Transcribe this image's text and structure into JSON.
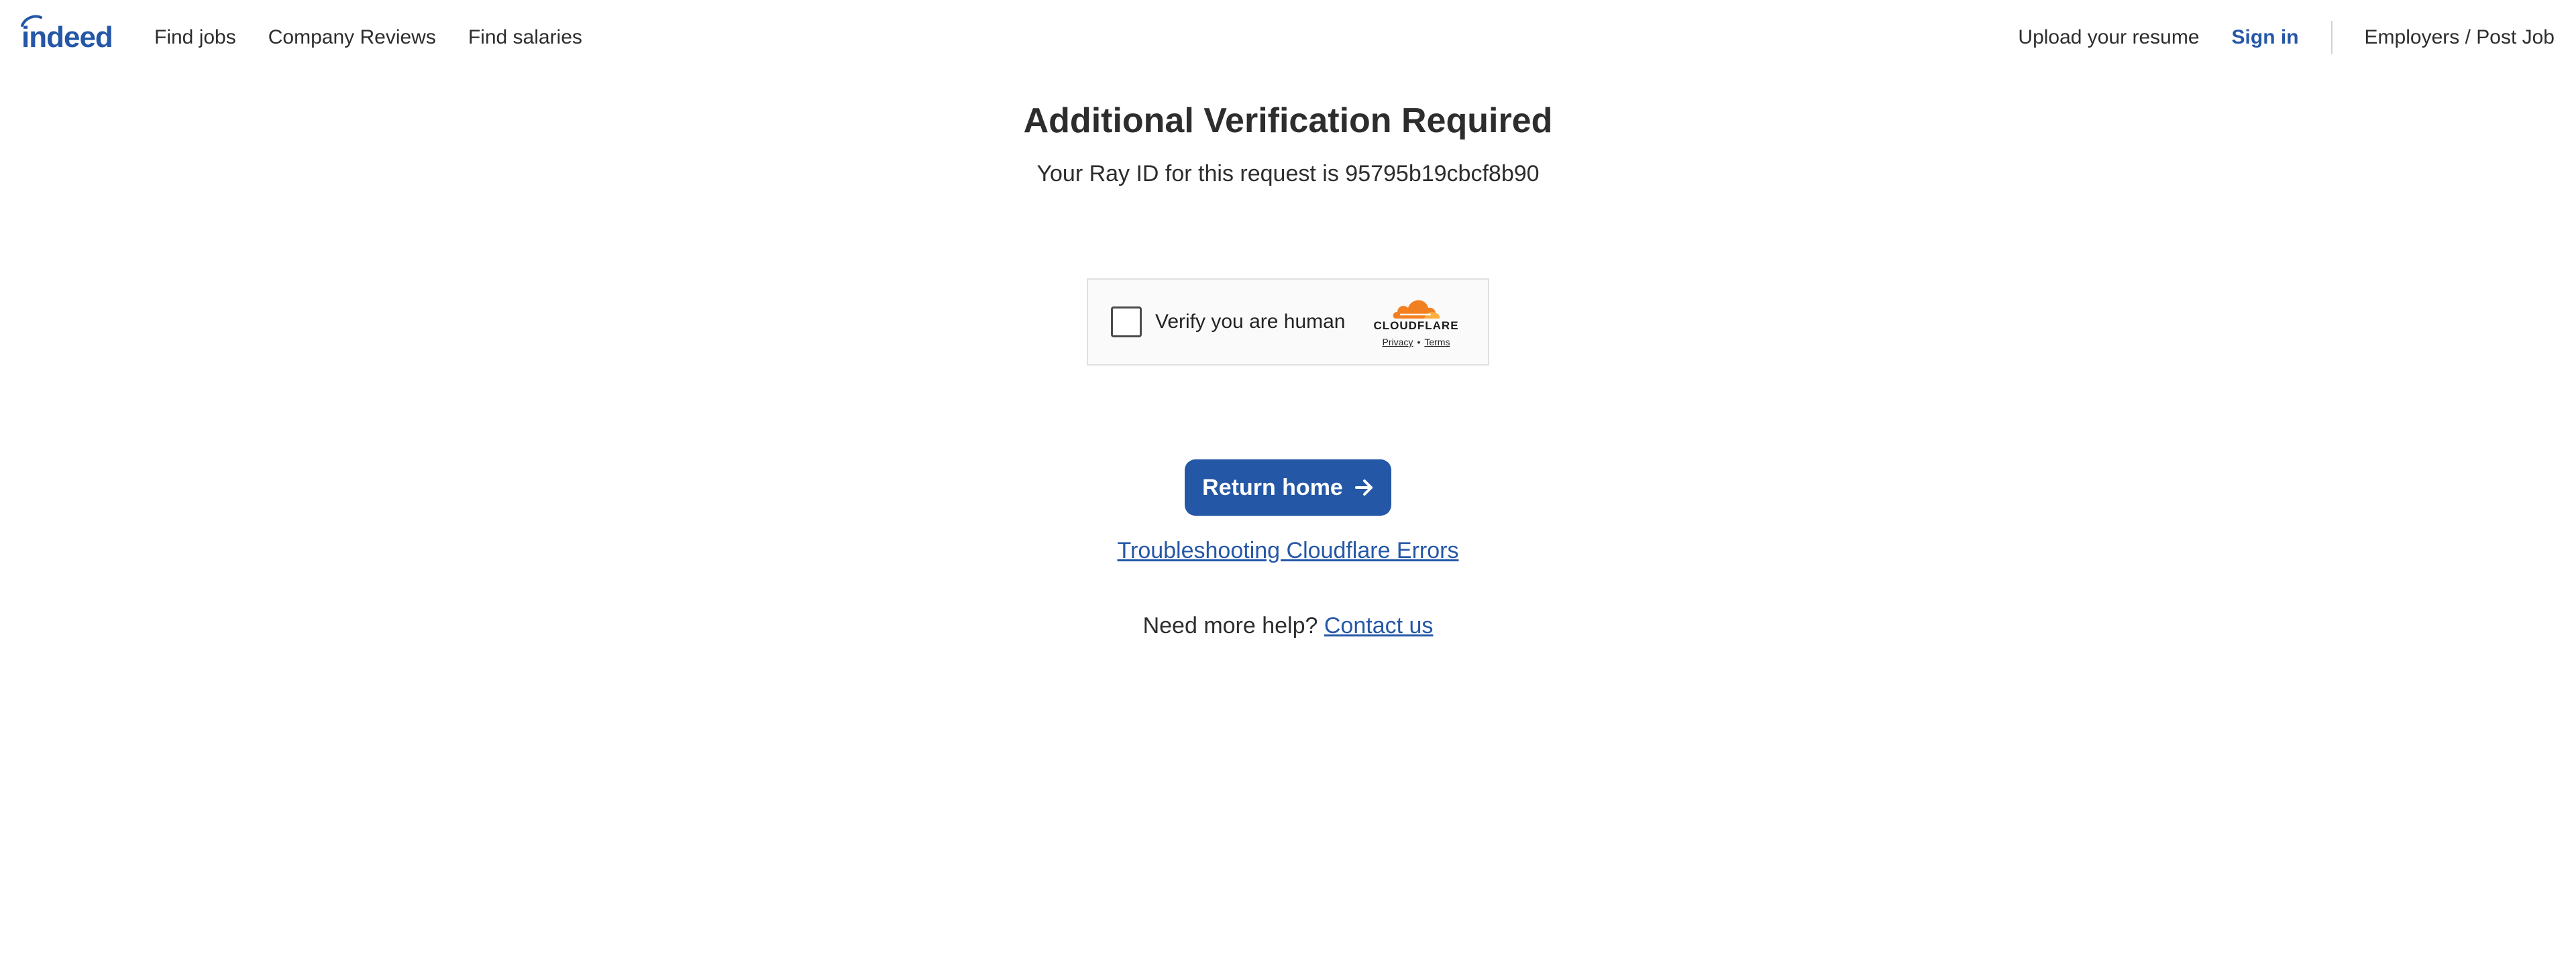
{
  "header": {
    "logo_text": "indeed",
    "nav_left": [
      {
        "label": "Find jobs"
      },
      {
        "label": "Company Reviews"
      },
      {
        "label": "Find salaries"
      }
    ],
    "upload_label": "Upload your resume",
    "signin_label": "Sign in",
    "employers_label": "Employers / Post Job"
  },
  "main": {
    "title": "Additional Verification Required",
    "ray_prefix": "Your Ray ID for this request is",
    "ray_id": "95795b19cbcf8b90",
    "turnstile": {
      "label": "Verify you are human",
      "brand": "CLOUDFLARE",
      "privacy": "Privacy",
      "separator": "•",
      "terms": "Terms"
    },
    "return_button": "Return home",
    "troubleshooting_link": "Troubleshooting Cloudflare Errors",
    "help_prefix": "Need more help?",
    "contact_link": "Contact us"
  },
  "colors": {
    "brand_blue": "#2557a7",
    "text": "#2d2d2d",
    "cloudflare_orange": "#f38020",
    "cloudflare_orange_light": "#faae40"
  },
  "icons": {
    "return_arrow": "arrow-right-icon",
    "cloudflare": "cloudflare-cloud-icon"
  }
}
